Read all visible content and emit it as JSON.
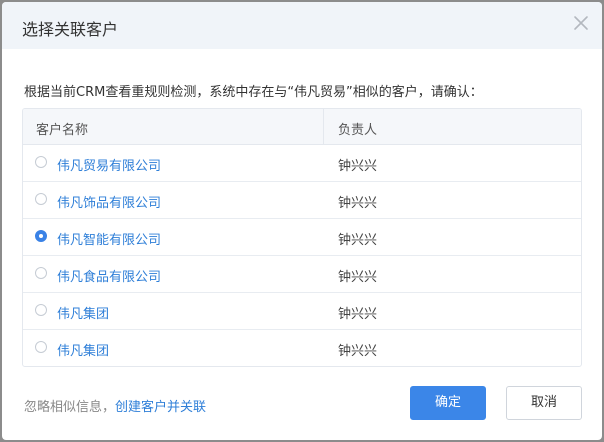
{
  "dialog": {
    "title": "选择关联客户",
    "prompt": "根据当前CRM查看重规则检测，系统中存在与“伟凡贸易”相似的客户，请确认：",
    "close_icon": "close-icon"
  },
  "table": {
    "headers": [
      "客户名称",
      "负责人"
    ],
    "rows": [
      {
        "name": "伟凡贸易有限公司",
        "owner": "钟兴兴",
        "selected": false
      },
      {
        "name": "伟凡饰品有限公司",
        "owner": "钟兴兴",
        "selected": false
      },
      {
        "name": "伟凡智能有限公司",
        "owner": "钟兴兴",
        "selected": true
      },
      {
        "name": "伟凡食品有限公司",
        "owner": "钟兴兴",
        "selected": false
      },
      {
        "name": "伟凡集团",
        "owner": "钟兴兴",
        "selected": false
      },
      {
        "name": "伟凡集团",
        "owner": "钟兴兴",
        "selected": false
      }
    ]
  },
  "footer": {
    "ignore_text": "忽略相似信息，",
    "create_link": "创建客户并关联",
    "ok_label": "确定",
    "cancel_label": "取消"
  },
  "colors": {
    "accent": "#3b86e8",
    "link": "#2f7fd8",
    "header_bg": "#f0f4f9"
  }
}
